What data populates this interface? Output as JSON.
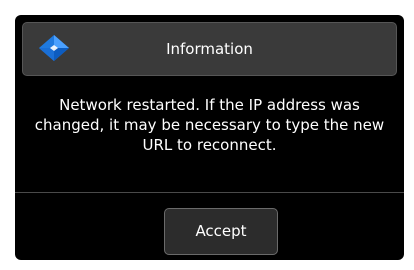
{
  "dialog": {
    "title": "Information",
    "logo_icon": "blue-diamond-logo-icon",
    "message": "Network restarted. If the IP address was changed, it may be necessary to type the new URL to reconnect.",
    "accept_label": "Accept"
  },
  "colors": {
    "background": "#000000",
    "titlebar": "#3a3a3a",
    "logo_blue": "#1f7ae0",
    "text": "#ffffff"
  }
}
